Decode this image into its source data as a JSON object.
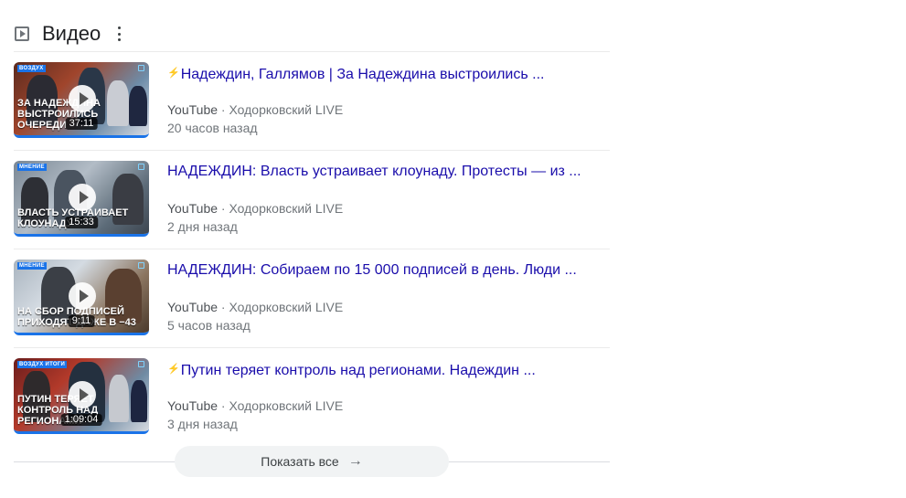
{
  "section": {
    "title": "Видео",
    "show_all_label": "Показать все"
  },
  "videos": [
    {
      "title": "Надеждин, Галлямов | За Надеждина выстроились ...",
      "live": true,
      "source": "YouTube",
      "channel": "Ходорковский LIVE",
      "time": "20 часов назад",
      "duration": "37:11",
      "thumb_tag": "ВОЗДУХ",
      "thumb_headline": "ЗА НАДЕЖДИНА ВЫСТРОИЛИСЬ ОЧЕРЕДИ"
    },
    {
      "title": "НАДЕЖДИН: Власть устраивает клоунаду. Протесты — из ...",
      "live": false,
      "source": "YouTube",
      "channel": "Ходорковский LIVE",
      "time": "2 дня назад",
      "duration": "15:33",
      "thumb_tag": "МНЕНИЕ",
      "thumb_headline": "ВЛАСТЬ УСТРАИВАЕТ КЛОУНАДУ"
    },
    {
      "title": "НАДЕЖДИН: Собираем по 15 000 подписей в день. Люди ...",
      "live": false,
      "source": "YouTube",
      "channel": "Ходорковский LIVE",
      "time": "5 часов назад",
      "duration": "9:11",
      "thumb_tag": "МНЕНИЕ",
      "thumb_headline": "НА СБОР ПОДПИСЕЙ ПРИХОДЯТ ДАЖЕ В −43"
    },
    {
      "title": "Путин теряет контроль над регионами. Надеждин ...",
      "live": true,
      "source": "YouTube",
      "channel": "Ходорковский LIVE",
      "time": "3 дня назад",
      "duration": "1:09:04",
      "thumb_tag": "ВОЗДУХ ИТОГИ",
      "thumb_headline": "ПУТИН ТЕРЯЕТ КОНТРОЛЬ НАД РЕГИОНАМИ"
    }
  ],
  "icons": {
    "header": "play-box-icon",
    "menu": "more-vert-icon",
    "thumb_play": "play-icon",
    "live": "lightning-icon",
    "show_all": "arrow-right-icon"
  },
  "colors": {
    "link": "#1a0dab",
    "meta": "#70757a",
    "live_bolt": "#f4c430",
    "thumb_accent": "#1a73e8"
  }
}
